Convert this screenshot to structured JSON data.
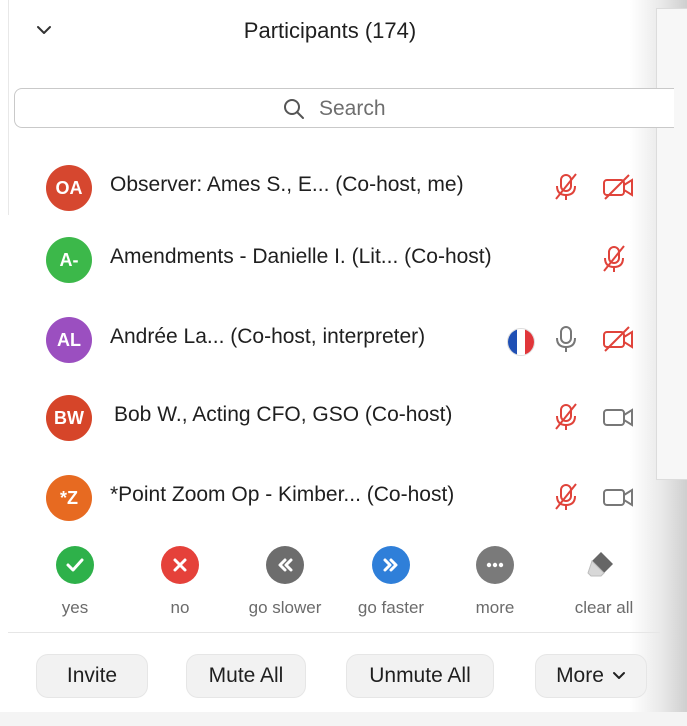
{
  "header": {
    "title": "Participants (174)"
  },
  "search": {
    "placeholder": "Search"
  },
  "participants": [
    {
      "initials": "OA",
      "name": "Observer: Ames S., E... (Co-host, me)",
      "avatar_color": "#d6472f",
      "mic": "muted",
      "video": "off"
    },
    {
      "initials": "A-",
      "name": "Amendments -  Danielle I. (Lit... (Co-host)",
      "avatar_color": "#3cb84a",
      "mic": "muted",
      "video": "none"
    },
    {
      "initials": "AL",
      "name": "Andrée La... (Co-host, interpreter)",
      "avatar_color": "#9b4fc0",
      "mic": "on",
      "video": "off",
      "badge": "flag-france"
    },
    {
      "initials": "BW",
      "name": "Bob W., Acting CFO, GSO (Co-host)",
      "avatar_color": "#d64529",
      "mic": "muted",
      "video": "on"
    },
    {
      "initials": "*Z",
      "name": "*Point Zoom Op - Kimber... (Co-host)",
      "avatar_color": "#e76a21",
      "mic": "muted",
      "video": "on"
    }
  ],
  "reactions": [
    {
      "label": "yes",
      "icon": "check-icon",
      "color": "#2eb14a"
    },
    {
      "label": "no",
      "icon": "x-icon",
      "color": "#e5413a"
    },
    {
      "label": "go slower",
      "icon": "rewind-icon",
      "color": "#6d6d6d"
    },
    {
      "label": "go faster",
      "icon": "fast-forward-icon",
      "color": "#2f7fd9"
    },
    {
      "label": "more",
      "icon": "more-dots-icon",
      "color": "#7a7a7a"
    },
    {
      "label": "clear all",
      "icon": "eraser-icon",
      "color": "#666666"
    }
  ],
  "footer": {
    "invite": "Invite",
    "mute_all": "Mute All",
    "unmute_all": "Unmute All",
    "more": "More"
  },
  "colors": {
    "muted_red": "#e0433a",
    "icon_gray": "#777777"
  }
}
